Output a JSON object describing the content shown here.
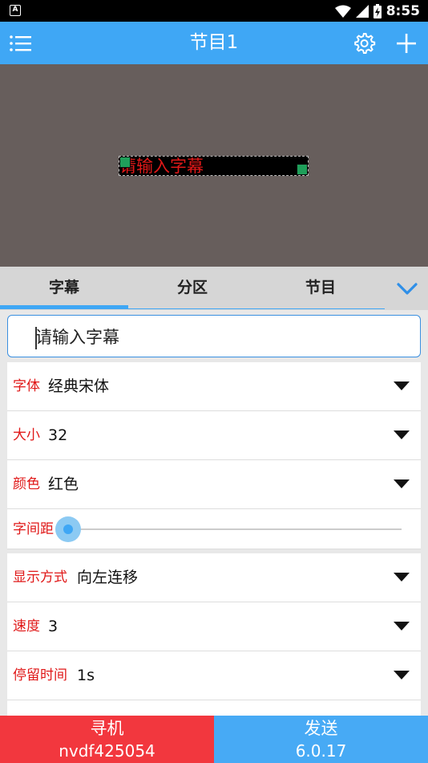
{
  "status_bar": {
    "time": "8:55",
    "app_badge": "A",
    "icons": [
      "wifi-icon",
      "signal-icon",
      "battery-icon"
    ]
  },
  "app_bar": {
    "title": "节目1",
    "icons": [
      "menu-icon",
      "gear-icon",
      "plus-icon"
    ]
  },
  "preview": {
    "caption_text": "请输入字幕",
    "caption_color": "#e01818",
    "background_color": "#675e5c"
  },
  "tabs": {
    "items": [
      {
        "label": "字幕"
      },
      {
        "label": "分区"
      },
      {
        "label": "节目"
      }
    ],
    "active_index": 0,
    "collapse_icon": "chevron-down-icon"
  },
  "caption_input": {
    "value": "请输入字幕"
  },
  "settings": {
    "font": {
      "label": "字体",
      "value": "经典宋体"
    },
    "size": {
      "label": "大小",
      "value": "32"
    },
    "color": {
      "label": "颜色",
      "value": "红色"
    },
    "spacing": {
      "label": "字间距",
      "level": 0
    },
    "display_mode": {
      "label": "显示方式",
      "value": "向左连移"
    },
    "speed": {
      "label": "速度",
      "value": "3"
    },
    "stay_time": {
      "label": "停留时间",
      "value": "1s"
    }
  },
  "bottom_bar": {
    "search": {
      "label": "寻机",
      "device": "nvdf425054"
    },
    "send": {
      "label": "发送",
      "version": "6.0.17"
    }
  },
  "colors": {
    "primary": "#3fa7f5",
    "accent_red": "#f2373e",
    "label_red": "#e01818"
  }
}
